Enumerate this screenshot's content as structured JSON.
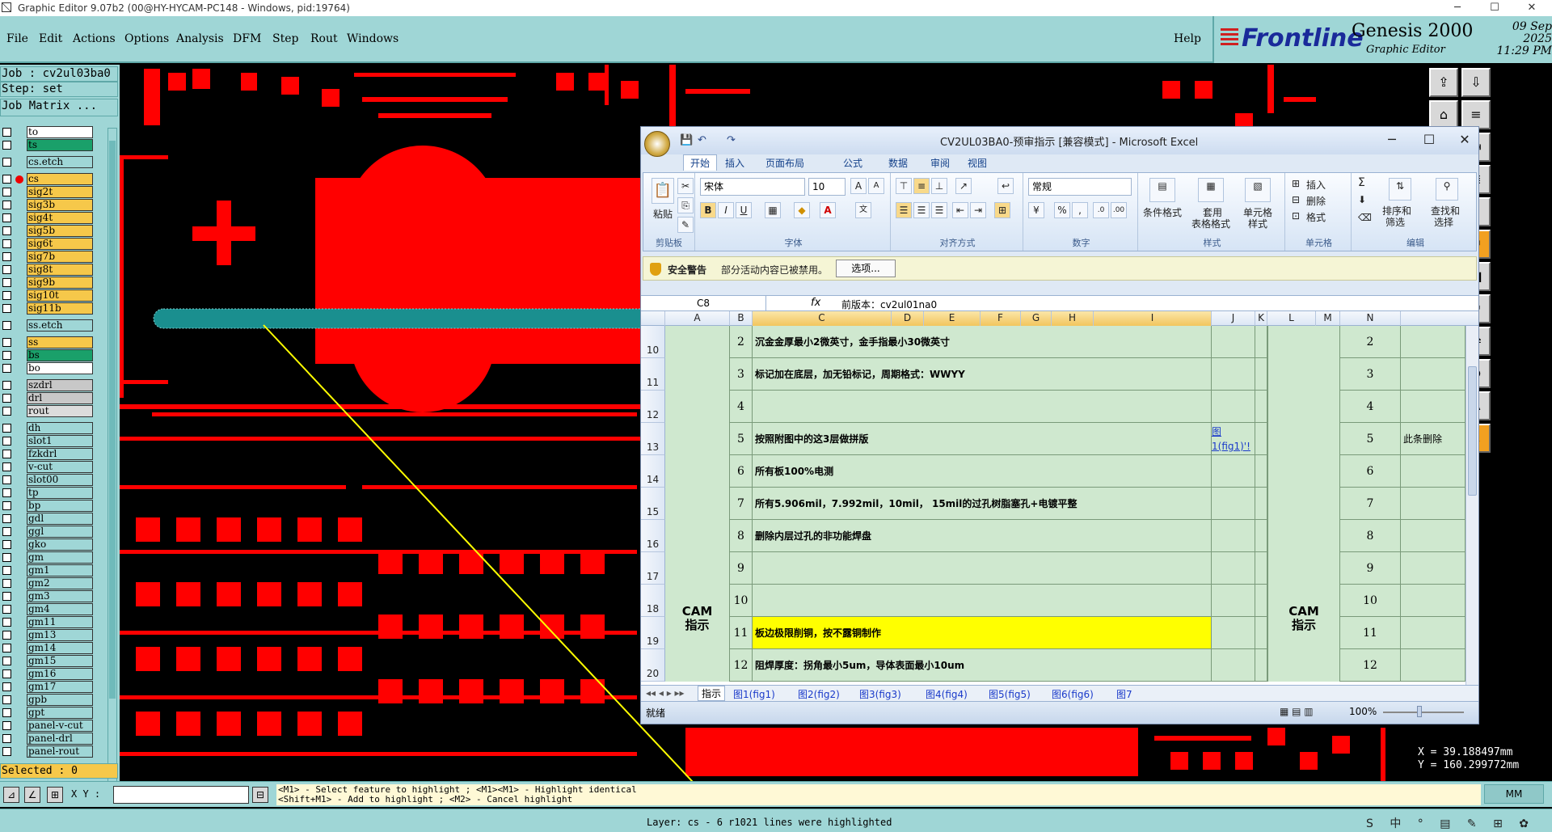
{
  "window": {
    "title": "Graphic Editor 9.07b2 (00@HY-HYCAM-PC148 - Windows, pid:19764)",
    "minimize": "─",
    "maximize": "☐",
    "close": "✕"
  },
  "menu": {
    "items": [
      "File",
      "Edit",
      "Actions",
      "Options",
      "Analysis",
      "DFM",
      "Step",
      "Rout",
      "Windows"
    ],
    "help": "Help"
  },
  "brand": {
    "logo": "Frontline",
    "product": "Genesis 2000",
    "subtitle": "Graphic Editor",
    "date": "09 Sep 2025",
    "time": "11:29 PM"
  },
  "job": {
    "job_line": "Job : cv2ul03ba0",
    "step_line": "Step: set",
    "matrix_button": "Job Matrix ..."
  },
  "layers": [
    {
      "name": "to",
      "color": "#ffffff",
      "group": 0
    },
    {
      "name": "ts",
      "color": "#1aa06a",
      "group": 0
    },
    {
      "name": "cs.etch",
      "color": "#9fd6d6",
      "group": 1
    },
    {
      "name": "cs",
      "color": "#f6c84a",
      "group": 2,
      "active": true
    },
    {
      "name": "sig2t",
      "color": "#f6c84a",
      "group": 2
    },
    {
      "name": "sig3b",
      "color": "#f6c84a",
      "group": 2
    },
    {
      "name": "sig4t",
      "color": "#f6c84a",
      "group": 2
    },
    {
      "name": "sig5b",
      "color": "#f6c84a",
      "group": 2
    },
    {
      "name": "sig6t",
      "color": "#f6c84a",
      "group": 2
    },
    {
      "name": "sig7b",
      "color": "#f6c84a",
      "group": 2
    },
    {
      "name": "sig8t",
      "color": "#f6c84a",
      "group": 2
    },
    {
      "name": "sig9b",
      "color": "#f6c84a",
      "group": 2
    },
    {
      "name": "sig10t",
      "color": "#f6c84a",
      "group": 2
    },
    {
      "name": "sig11b",
      "color": "#f6c84a",
      "group": 2
    },
    {
      "name": "ss.etch",
      "color": "#9fd6d6",
      "group": 3
    },
    {
      "name": "ss",
      "color": "#f6c84a",
      "group": 4
    },
    {
      "name": "bs",
      "color": "#1aa06a",
      "group": 4
    },
    {
      "name": "bo",
      "color": "#ffffff",
      "group": 4
    },
    {
      "name": "szdrl",
      "color": "#c8c8c8",
      "group": 5
    },
    {
      "name": "drl",
      "color": "#c8c8c8",
      "group": 5
    },
    {
      "name": "rout",
      "color": "#dcdcdc",
      "group": 5
    },
    {
      "name": "dh",
      "color": "#9fd6d6",
      "group": 6
    },
    {
      "name": "slot1",
      "color": "#9fd6d6",
      "group": 6
    },
    {
      "name": "fzkdrl",
      "color": "#9fd6d6",
      "group": 6
    },
    {
      "name": "v-cut",
      "color": "#9fd6d6",
      "group": 6
    },
    {
      "name": "slot00",
      "color": "#9fd6d6",
      "group": 6
    },
    {
      "name": "tp",
      "color": "#9fd6d6",
      "group": 6
    },
    {
      "name": "bp",
      "color": "#9fd6d6",
      "group": 6
    },
    {
      "name": "gdl",
      "color": "#9fd6d6",
      "group": 6
    },
    {
      "name": "ggl",
      "color": "#9fd6d6",
      "group": 6
    },
    {
      "name": "gko",
      "color": "#9fd6d6",
      "group": 6
    },
    {
      "name": "gm",
      "color": "#9fd6d6",
      "group": 6
    },
    {
      "name": "gm1",
      "color": "#9fd6d6",
      "group": 6
    },
    {
      "name": "gm2",
      "color": "#9fd6d6",
      "group": 6
    },
    {
      "name": "gm3",
      "color": "#9fd6d6",
      "group": 6
    },
    {
      "name": "gm4",
      "color": "#9fd6d6",
      "group": 6
    },
    {
      "name": "gm11",
      "color": "#9fd6d6",
      "group": 6
    },
    {
      "name": "gm13",
      "color": "#9fd6d6",
      "group": 6
    },
    {
      "name": "gm14",
      "color": "#9fd6d6",
      "group": 6
    },
    {
      "name": "gm15",
      "color": "#9fd6d6",
      "group": 6
    },
    {
      "name": "gm16",
      "color": "#9fd6d6",
      "group": 6
    },
    {
      "name": "gm17",
      "color": "#9fd6d6",
      "group": 6
    },
    {
      "name": "gpb",
      "color": "#9fd6d6",
      "group": 6
    },
    {
      "name": "gpt",
      "color": "#9fd6d6",
      "group": 6
    },
    {
      "name": "panel-v-cut",
      "color": "#9fd6d6",
      "group": 6
    },
    {
      "name": "panel-drl",
      "color": "#9fd6d6",
      "group": 6
    },
    {
      "name": "panel-rout",
      "color": "#9fd6d6",
      "group": 6
    }
  ],
  "selected": "Selected : 0",
  "coords": {
    "x": "X = 39.188497mm",
    "y": "Y = 160.299772mm"
  },
  "bottom": {
    "xy_label": "X Y :",
    "xy_value": "",
    "hint_line1": "<M1> - Select feature to highlight ; <M1><M1> - Highlight identical",
    "hint_line2": "<Shift+M1> - Add to highlight ; <M2> - Cancel highlight",
    "units": "MM",
    "status": "Layer: cs - 6 r1021 lines were highlighted",
    "tray": "S 中 ° ▤ ✎ ⊞ ✿"
  },
  "tools": [
    "⇪",
    "⇩",
    "⌂",
    "≡",
    "⇤",
    "⇥",
    "⇆",
    "≣",
    "1:2",
    "?",
    "⚑",
    "⚑",
    "▭",
    "■",
    "↗",
    "↗",
    "⤴",
    "⇌",
    "⊕",
    "⊕",
    "A",
    "A",
    "↖",
    "↖"
  ],
  "excel": {
    "title": "CV2UL03BA0-预审指示  [兼容模式] - Microsoft Excel",
    "ribbon_tabs": [
      "开始",
      "插入",
      "页面布局",
      "公式",
      "数据",
      "审阅",
      "视图"
    ],
    "font_name": "宋体",
    "font_size": "10",
    "number_format": "常规",
    "groups": {
      "clipboard": "剪贴板",
      "font": "字体",
      "align": "对齐方式",
      "number": "数字",
      "style": "样式",
      "cells": "单元格",
      "edit": "编辑"
    },
    "buttons": {
      "paste": "粘贴",
      "cond_format": "条件格式",
      "table_format1": "套用",
      "table_format2": "表格格式",
      "cell_style1": "单元格",
      "cell_style2": "样式",
      "insert": "插入",
      "delete": "删除",
      "format": "格式",
      "sort1": "排序和",
      "sort2": "筛选",
      "find1": "查找和",
      "find2": "选择",
      "bold": "B",
      "italic": "I",
      "underline": "U",
      "sum": "Σ",
      "percent": "%",
      "comma": ","
    },
    "security": {
      "label": "安全警告",
      "message": "部分活动内容已被禁用。",
      "options": "选项..."
    },
    "name_box": "C8",
    "fx": "fx",
    "formula": "前版本：cv2ul01na0",
    "columns": [
      "A",
      "B",
      "C",
      "D",
      "E",
      "F",
      "G",
      "H",
      "I",
      "J",
      "K",
      "L",
      "M",
      "N"
    ],
    "merged_label": "CAM\n指示",
    "rows": [
      {
        "row": "10",
        "no": "2",
        "text": "沉金金厚最小2微英寸，金手指最小30微英寸",
        "j": "",
        "m": "2",
        "n": ""
      },
      {
        "row": "11",
        "no": "3",
        "text": "标记加在底层，加无铅标记，周期格式：WWYY",
        "j": "",
        "m": "3",
        "n": ""
      },
      {
        "row": "12",
        "no": "4",
        "text": "",
        "j": "",
        "m": "4",
        "n": ""
      },
      {
        "row": "13",
        "no": "5",
        "text": "按照附图中的这3层做拼版",
        "j": "图1(fig1)'!",
        "m": "5",
        "n": "此条删除"
      },
      {
        "row": "14",
        "no": "6",
        "text": "所有板100%电测",
        "j": "",
        "m": "6",
        "n": ""
      },
      {
        "row": "15",
        "no": "7",
        "text": "所有5.906mil，7.992mil，10mil， 15mil的过孔树脂塞孔+电镀平整",
        "j": "",
        "m": "7",
        "n": ""
      },
      {
        "row": "16",
        "no": "8",
        "text": "删除内层过孔的非功能焊盘",
        "j": "",
        "m": "8",
        "n": ""
      },
      {
        "row": "17",
        "no": "9",
        "text": "",
        "j": "",
        "m": "9",
        "n": ""
      },
      {
        "row": "18",
        "no": "10",
        "text": "",
        "j": "",
        "m": "10",
        "n": ""
      },
      {
        "row": "19",
        "no": "11",
        "text": "板边极限削铜，按不露铜制作",
        "j": "",
        "m": "11",
        "n": "",
        "highlight": true
      },
      {
        "row": "20",
        "no": "12",
        "text": "阻焊厚度：拐角最小5um，导体表面最小10um",
        "j": "",
        "m": "12",
        "n": ""
      }
    ],
    "sheets": [
      "指示",
      "图1(fig1)",
      "图2(fig2)",
      "图3(fig3)",
      "图4(fig4)",
      "图5(fig5)",
      "图6(fig6)",
      "图7"
    ],
    "status_ready": "就绪",
    "zoom": "100%"
  }
}
